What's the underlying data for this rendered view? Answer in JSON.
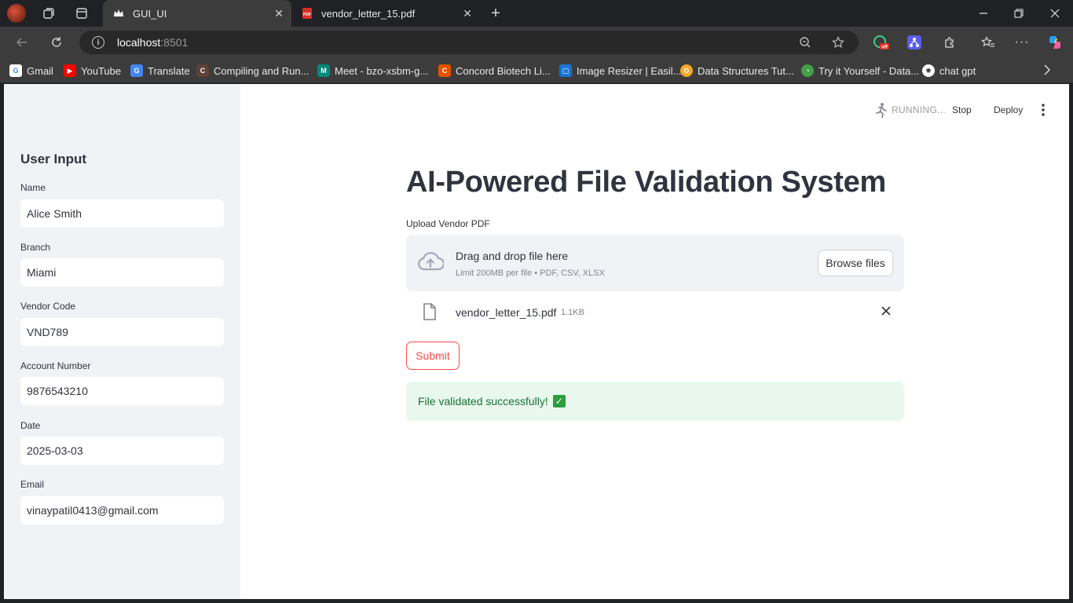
{
  "browser": {
    "tabs": [
      {
        "title": "GUI_UI",
        "favicon": "crown-icon",
        "active": true
      },
      {
        "title": "vendor_letter_15.pdf",
        "favicon": "pdf-icon",
        "active": false
      }
    ],
    "address": {
      "host": "localhost",
      "port": ":8501"
    },
    "bookmarks": [
      {
        "label": "Gmail",
        "icon": "google-icon",
        "color": "#4285f4",
        "glyph": "G"
      },
      {
        "label": "YouTube",
        "icon": "youtube-icon",
        "color": "#ff0000",
        "glyph": "▶"
      },
      {
        "label": "Translate",
        "icon": "translate-icon",
        "color": "#4285f4",
        "glyph": "G"
      },
      {
        "label": "Compiling and Run...",
        "icon": "compile-icon",
        "color": "#6b6b6b",
        "glyph": "C"
      },
      {
        "label": "Meet - bzo-xsbm-g...",
        "icon": "meet-icon",
        "color": "#00897b",
        "glyph": "M"
      },
      {
        "label": "Concord Biotech Li...",
        "icon": "concord-icon",
        "color": "#e65100",
        "glyph": "C"
      },
      {
        "label": "Image Resizer | Easil...",
        "icon": "image-resizer-icon",
        "color": "#1976d2",
        "glyph": "▢"
      },
      {
        "label": "Data Structures Tut...",
        "icon": "data-structures-icon",
        "color": "#f9a825",
        "glyph": "G"
      },
      {
        "label": "Try it Yourself - Data...",
        "icon": "try-it-icon",
        "color": "#43a047",
        "glyph": "◔"
      },
      {
        "label": "chat gpt",
        "icon": "chatgpt-icon",
        "color": "#555555",
        "glyph": "✺"
      }
    ]
  },
  "sidebar": {
    "title": "User Input",
    "fields": [
      {
        "label": "Name",
        "value": "Alice Smith"
      },
      {
        "label": "Branch",
        "value": "Miami"
      },
      {
        "label": "Vendor Code",
        "value": "VND789"
      },
      {
        "label": "Account Number",
        "value": "9876543210"
      },
      {
        "label": "Date",
        "value": "2025-03-03"
      },
      {
        "label": "Email",
        "value": "vinaypatil0413@gmail.com"
      }
    ]
  },
  "header": {
    "status": "RUNNING...",
    "stop": "Stop",
    "deploy": "Deploy"
  },
  "main": {
    "title": "AI-Powered File Validation System",
    "uploader": {
      "label": "Upload Vendor PDF",
      "drop_text": "Drag and drop file here",
      "limit_text": "Limit 200MB per file • PDF, CSV, XLSX",
      "browse_label": "Browse files"
    },
    "uploaded_file": {
      "name": "vendor_letter_15.pdf",
      "size": "1.1KB"
    },
    "submit_label": "Submit",
    "success_message": "File validated successfully!",
    "success_color": "#177233",
    "accent_color": "#ff4b4b"
  }
}
